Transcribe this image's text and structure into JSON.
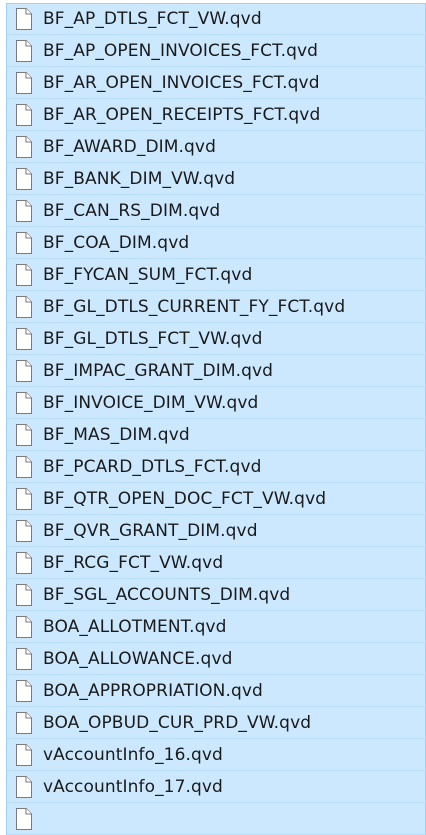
{
  "files": [
    {
      "name": "BF_AP_DTLS_FCT_VW.qvd",
      "selected": true
    },
    {
      "name": "BF_AP_OPEN_INVOICES_FCT.qvd",
      "selected": true
    },
    {
      "name": "BF_AR_OPEN_INVOICES_FCT.qvd",
      "selected": true
    },
    {
      "name": "BF_AR_OPEN_RECEIPTS_FCT.qvd",
      "selected": true
    },
    {
      "name": "BF_AWARD_DIM.qvd",
      "selected": true
    },
    {
      "name": "BF_BANK_DIM_VW.qvd",
      "selected": true
    },
    {
      "name": "BF_CAN_RS_DIM.qvd",
      "selected": true
    },
    {
      "name": "BF_COA_DIM.qvd",
      "selected": true
    },
    {
      "name": "BF_FYCAN_SUM_FCT.qvd",
      "selected": true
    },
    {
      "name": "BF_GL_DTLS_CURRENT_FY_FCT.qvd",
      "selected": true
    },
    {
      "name": "BF_GL_DTLS_FCT_VW.qvd",
      "selected": true
    },
    {
      "name": "BF_IMPAC_GRANT_DIM.qvd",
      "selected": true
    },
    {
      "name": "BF_INVOICE_DIM_VW.qvd",
      "selected": true
    },
    {
      "name": "BF_MAS_DIM.qvd",
      "selected": true
    },
    {
      "name": "BF_PCARD_DTLS_FCT.qvd",
      "selected": true
    },
    {
      "name": "BF_QTR_OPEN_DOC_FCT_VW.qvd",
      "selected": true
    },
    {
      "name": "BF_QVR_GRANT_DIM.qvd",
      "selected": true
    },
    {
      "name": "BF_RCG_FCT_VW.qvd",
      "selected": true
    },
    {
      "name": "BF_SGL_ACCOUNTS_DIM.qvd",
      "selected": true
    },
    {
      "name": "BOA_ALLOTMENT.qvd",
      "selected": true
    },
    {
      "name": "BOA_ALLOWANCE.qvd",
      "selected": true
    },
    {
      "name": "BOA_APPROPRIATION.qvd",
      "selected": true
    },
    {
      "name": "BOA_OPBUD_CUR_PRD_VW.qvd",
      "selected": true
    },
    {
      "name": "vAccountInfo_16.qvd",
      "selected": true
    },
    {
      "name": "vAccountInfo_17.qvd",
      "selected": true
    },
    {
      "name": "",
      "selected": true
    }
  ],
  "colors": {
    "selection_fill": "#cce8ff",
    "selection_border": "#99d1ff"
  },
  "icons": {
    "file": "document-file-icon"
  }
}
